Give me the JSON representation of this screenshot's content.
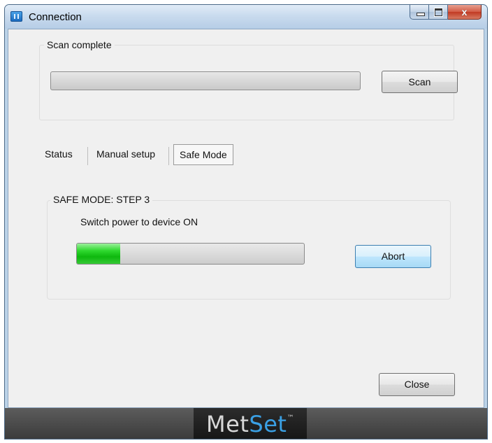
{
  "window": {
    "title": "Connection",
    "icon": "app-icon",
    "controls": {
      "minimize": "minimize-icon",
      "maximize": "maximize-icon",
      "close_glyph": "x"
    }
  },
  "scan": {
    "status_label": "Scan complete",
    "progress_fraction": 0,
    "scan_button": "Scan"
  },
  "tabs": [
    {
      "label": "Status",
      "selected": false
    },
    {
      "label": "Manual setup",
      "selected": false
    },
    {
      "label": "Safe Mode",
      "selected": true
    }
  ],
  "safe_mode": {
    "step_label": "SAFE MODE: STEP 3",
    "instruction": "Switch power to device ON",
    "progress_fraction": 0.19,
    "progress_color": "#12c312",
    "abort_button": "Abort"
  },
  "close_button": "Close",
  "footer": {
    "logo_part1": "Met",
    "logo_part2": "Set",
    "logo_tm": "™",
    "logo_color_accent": "#3aa0e4"
  }
}
